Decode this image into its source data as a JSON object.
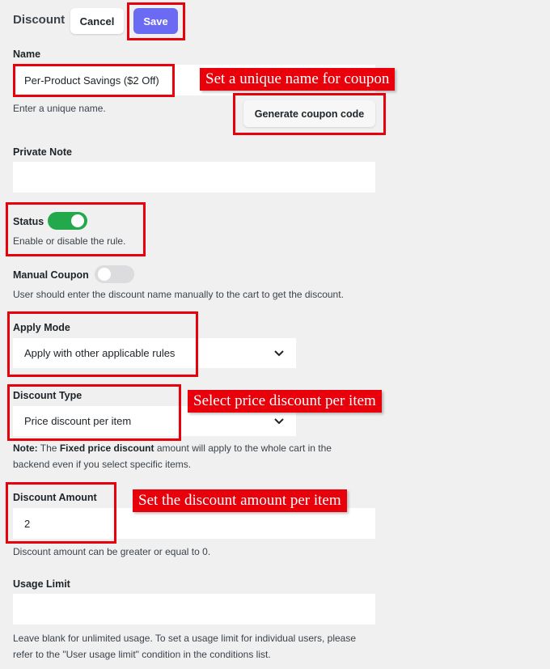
{
  "header": {
    "title": "Discount",
    "cancel_label": "Cancel",
    "save_label": "Save"
  },
  "name": {
    "label": "Name",
    "value": "Per-Product Savings ($2 Off)",
    "help": "Enter a unique name.",
    "generate_label": "Generate coupon code"
  },
  "private_note": {
    "label": "Private Note",
    "value": ""
  },
  "status": {
    "label": "Status",
    "enabled": true,
    "help": "Enable or disable the rule.",
    "on_color": "#23a94b"
  },
  "manual_coupon": {
    "label": "Manual Coupon",
    "enabled": false,
    "help": "User should enter the discount name manually to the cart to get the discount."
  },
  "apply_mode": {
    "label": "Apply Mode",
    "selected": "Apply with other applicable rules"
  },
  "discount_type": {
    "label": "Discount Type",
    "selected": "Price discount per item",
    "note_prefix": "Note:",
    "note_text1": " The ",
    "note_bold": "Fixed price discount",
    "note_text2": " amount will apply to the whole cart in the backend even if you select specific items."
  },
  "discount_amount": {
    "label": "Discount Amount",
    "value": "2",
    "help": "Discount amount can be greater or equal to 0."
  },
  "usage_limit": {
    "label": "Usage Limit",
    "value": "",
    "help": "Leave blank for unlimited usage. To set a usage limit for individual users, please refer to the \"User usage limit\" condition in the conditions list."
  },
  "annotations": {
    "name_callout": "Set a unique name for coupon",
    "type_callout": "Select price discount per item",
    "amount_callout": "Set the discount amount per item",
    "highlight_color": "#e8000b"
  },
  "icons": {
    "select_arrow": "chevron-down-icon"
  },
  "colors": {
    "accent": "#6b6af2",
    "background": "#f0f0f1",
    "toggle_off": "#dcdcde"
  }
}
